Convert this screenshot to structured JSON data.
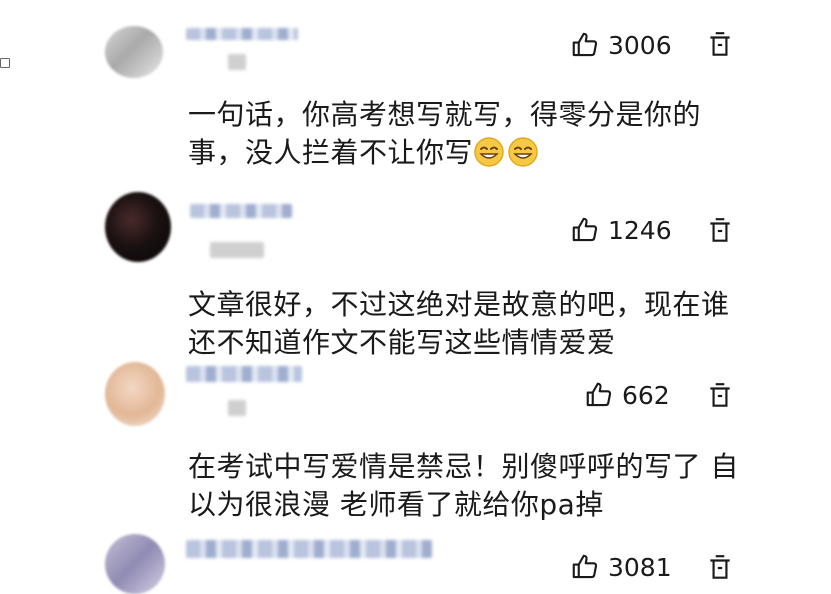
{
  "comments": [
    {
      "likes": "3006",
      "text": "一句话，你高考想写就写，得零分是你的事，没人拦着不让你写",
      "emojis": [
        "grinning-face-emoji",
        "grinning-face-emoji"
      ]
    },
    {
      "likes": "1246",
      "text": "文章很好，不过这绝对是故意的吧，现在谁还不知道作文不能写这些情情爱爱"
    },
    {
      "likes": "662",
      "text": "在考试中写爱情是禁忌！别傻呼呼的写了 自以为很浪漫 老师看了就给你pa掉"
    },
    {
      "likes": "3081"
    }
  ],
  "icons": {
    "like": "thumbs-up-icon",
    "delete": "trash-icon"
  },
  "colors": {
    "text": "#1a1a1a",
    "background": "#ffffff"
  }
}
